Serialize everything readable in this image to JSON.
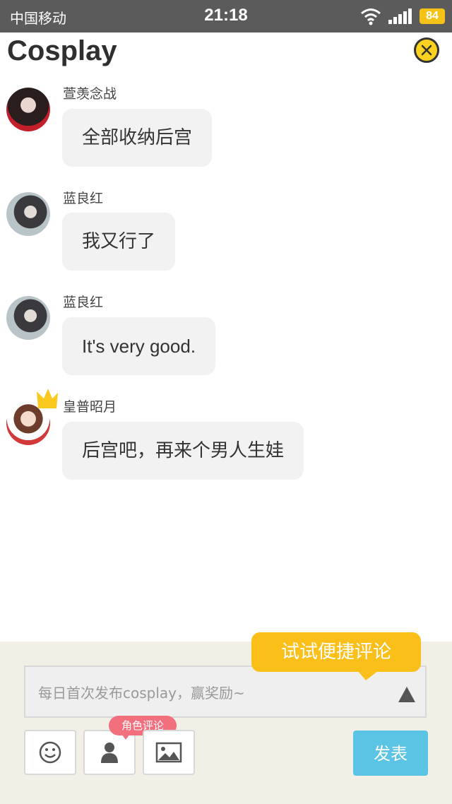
{
  "status_bar": {
    "carrier": "中国移动",
    "time": "21:18",
    "battery": "84"
  },
  "header": {
    "title": "Cosplay",
    "close_icon": "close-circle-icon"
  },
  "messages": [
    {
      "user": "萱羡念战",
      "text": "全部收纳后宫"
    },
    {
      "user": "蓝良红",
      "text": "我又行了"
    },
    {
      "user": "蓝良红",
      "text": "It's very good."
    },
    {
      "user": "皇普昭月",
      "text": "后宫吧，再来个男人生娃"
    }
  ],
  "composer": {
    "placeholder": "每日首次发布cosplay，赢奖励~",
    "quick_tip": "试试便捷评论",
    "role_tag": "角色评论",
    "send_label": "发表"
  },
  "colors": {
    "accent_yellow": "#fbbf1a",
    "send_blue": "#5bc3e3",
    "tag_pink": "#f26f7e"
  }
}
